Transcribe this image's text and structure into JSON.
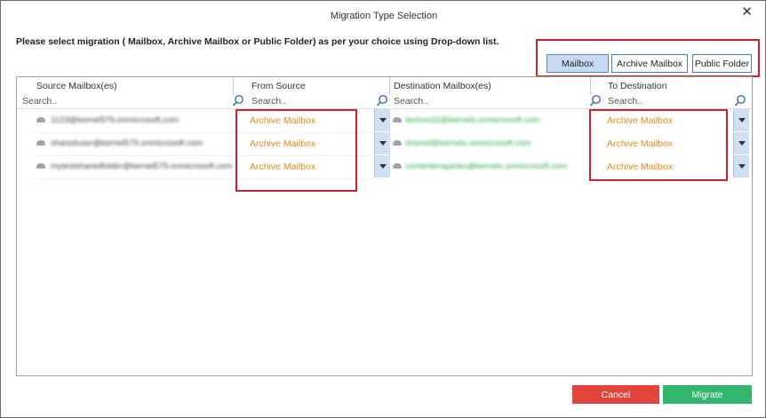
{
  "dialog": {
    "title": "Migration Type Selection",
    "close_label": "✕",
    "instruction": "Please select migration ( Mailbox, Archive Mailbox or Public Folder) as per your choice using Drop-down list."
  },
  "type_buttons": [
    {
      "label": "Mailbox",
      "selected": true
    },
    {
      "label": "Archive Mailbox",
      "selected": false
    },
    {
      "label": "Public Folder",
      "selected": false
    }
  ],
  "columns": {
    "source": "Source Mailbox(es)",
    "from_source": "From Source",
    "destination": "Destination Mailbox(es)",
    "to_destination": "To Destination"
  },
  "search": {
    "placeholder": "Search.."
  },
  "rows": [
    {
      "source": "1123@kernel579.onmicrosoft.com",
      "from": "Archive Mailbox",
      "destination": "techno33@kernels.onmicrosoft.com",
      "to": "Archive Mailbox"
    },
    {
      "source": "shareduser@kernel579.onmicrosoft.com",
      "from": "Archive Mailbox",
      "destination": "shared@kernels.onmicrosoft.com",
      "to": "Archive Mailbox"
    },
    {
      "source": "mytestsharedfolder@kernel579.onmicrosoft.com",
      "from": "Archive Mailbox",
      "destination": "contentenquiries@kernels.onmicrosoft.com",
      "to": "Archive Mailbox"
    }
  ],
  "footer": {
    "cancel_label": "Cancel",
    "migrate_label": "Migrate"
  },
  "colors": {
    "accent_red": "#d0202a",
    "dropdown_text": "#e08a1e",
    "destination_text": "#2aa845",
    "cancel_bg": "#e0443b",
    "migrate_bg": "#32b66d",
    "selected_button": "#c7d9f3"
  },
  "icons": {
    "search": "magnifier-icon",
    "dropdown": "chevron-down-icon",
    "mailbox": "cloud-icon",
    "close": "close-icon"
  }
}
